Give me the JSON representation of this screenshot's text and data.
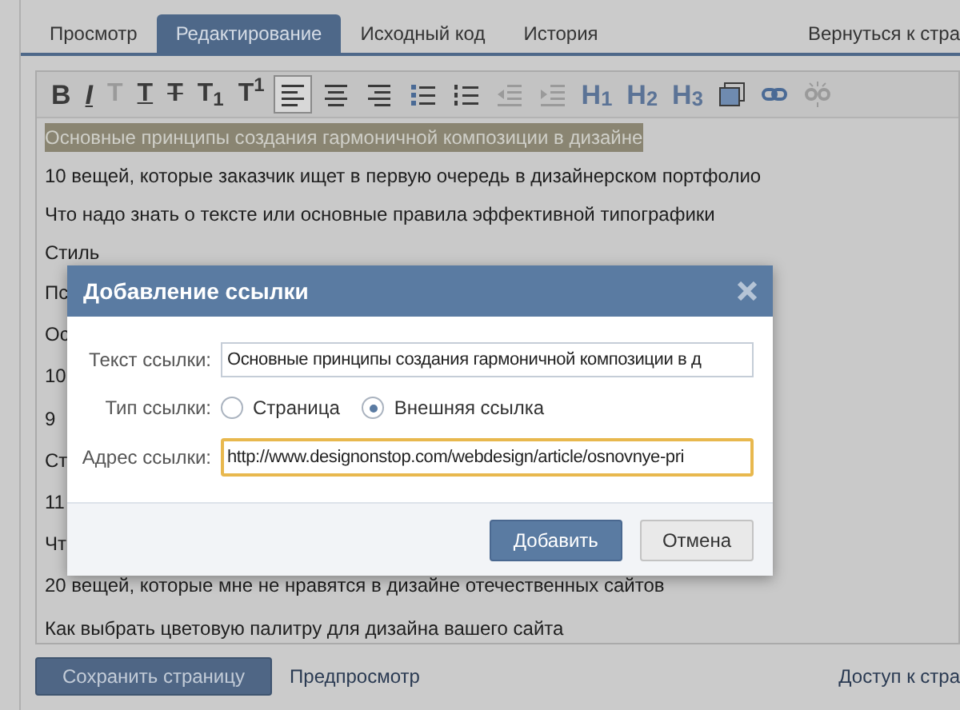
{
  "tabs": [
    {
      "label": "Просмотр",
      "selected": false
    },
    {
      "label": "Редактирование",
      "selected": true
    },
    {
      "label": "Исходный код",
      "selected": false
    },
    {
      "label": "История",
      "selected": false
    }
  ],
  "back_link": "Вернуться к стра",
  "toolbar": [
    {
      "kind": "bold",
      "label": "B",
      "disabled": false,
      "selected": false
    },
    {
      "kind": "italic",
      "label": "I",
      "disabled": false,
      "selected": false
    },
    {
      "kind": "plain",
      "label": "T",
      "disabled": true,
      "selected": false
    },
    {
      "kind": "underline",
      "label": "T",
      "disabled": false,
      "selected": false
    },
    {
      "kind": "strike",
      "label": "T",
      "disabled": false,
      "selected": false
    },
    {
      "kind": "plain",
      "label": "T$_{1}$",
      "disabled": false,
      "selected": false
    },
    {
      "kind": "plain",
      "label": "T$^{1}$",
      "disabled": false,
      "selected": false
    },
    {
      "kind": "align-left",
      "disabled": false,
      "selected": true
    },
    {
      "kind": "align-center",
      "disabled": false,
      "selected": false
    },
    {
      "kind": "align-right",
      "disabled": false,
      "selected": false
    },
    {
      "kind": "bullet-list",
      "disabled": false,
      "selected": false
    },
    {
      "kind": "numbered-list",
      "disabled": false,
      "selected": false
    },
    {
      "kind": "outdent",
      "disabled": true,
      "selected": false
    },
    {
      "kind": "indent",
      "disabled": true,
      "selected": false
    },
    {
      "kind": "heading",
      "label": "H$_{1}$",
      "disabled": false,
      "selected": false
    },
    {
      "kind": "heading",
      "label": "H$_{2}$",
      "disabled": false,
      "selected": false
    },
    {
      "kind": "heading",
      "label": "H$_{3}$",
      "disabled": false,
      "selected": false
    },
    {
      "kind": "image",
      "disabled": false,
      "selected": false
    },
    {
      "kind": "link",
      "disabled": false,
      "selected": false
    },
    {
      "kind": "unlink",
      "disabled": true,
      "selected": false
    }
  ],
  "editor": {
    "lines": [
      {
        "text": "Основные принципы создания гармоничной композиции в дизайне",
        "highlighted": true
      },
      {
        "text": "10 вещей, которые заказчик ищет в первую очередь в дизайнерском портфолио",
        "highlighted": false
      },
      {
        "text": "Что надо знать о тексте или основные правила эффективной типографики",
        "highlighted": false
      },
      {
        "text": "Стиль",
        "highlighted": false
      },
      {
        "text": "Пс",
        "highlighted": false
      },
      {
        "text": "Ос",
        "highlighted": false
      },
      {
        "text": "10",
        "highlighted": false
      },
      {
        "text": "9",
        "highlighted": false
      },
      {
        "text": "Ст",
        "highlighted": false
      },
      {
        "text": "11",
        "highlighted": false
      },
      {
        "text": "Чт",
        "highlighted": false
      },
      {
        "text": "20 вещей, которые мне не нравятся в дизайне отечественных сайтов",
        "highlighted": false
      },
      {
        "text": "Как выбрать цветовую палитру для дизайна вашего сайта",
        "highlighted": false
      }
    ]
  },
  "dialog": {
    "title": "Добавление ссылки",
    "link_text": {
      "label": "Текст ссылки:",
      "value": "Основные принципы создания гармоничной композиции в д"
    },
    "link_type": {
      "label": "Тип ссылки:",
      "options": [
        {
          "label": "Страница",
          "selected": false
        },
        {
          "label": "Внешняя ссылка",
          "selected": true
        }
      ]
    },
    "link_address": {
      "label": "Адрес ссылки:",
      "value": "http://www.designonstop.com/webdesign/article/osnovnye-pri"
    },
    "buttons": [
      {
        "kind": "primary",
        "label": "Добавить"
      },
      {
        "kind": "secondary",
        "label": "Отмена"
      }
    ]
  },
  "footer": {
    "save_button": "Сохранить страницу",
    "preview_link": "Предпросмотр",
    "access_link": "Доступ к стра"
  }
}
